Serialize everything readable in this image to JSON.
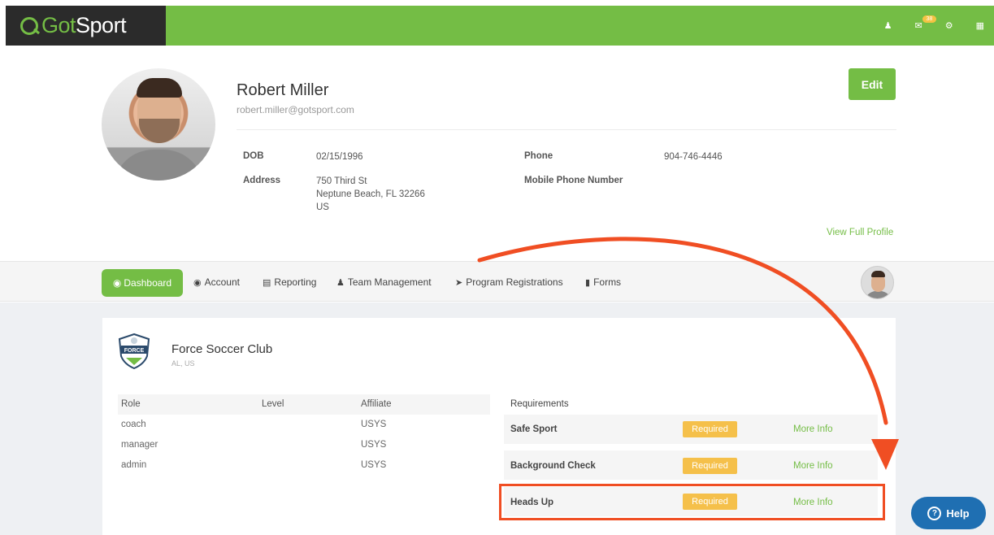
{
  "header": {
    "logo_prefix": "Got",
    "logo_suffix": "Sport",
    "mail_count": "38",
    "brand_color": "#74bd45"
  },
  "profile": {
    "name": "Robert Miller",
    "email": "robert.miller@gotsport.com",
    "edit_label": "Edit",
    "dob_label": "DOB",
    "dob_value": "02/15/1996",
    "address_label": "Address",
    "address_line1": "750 Third St",
    "address_line2": "Neptune Beach, FL 32266",
    "address_line3": "US",
    "phone_label": "Phone",
    "phone_value": "904-746-4446",
    "mobile_label": "Mobile Phone Number",
    "view_full_profile": "View Full Profile"
  },
  "nav": {
    "items": [
      {
        "label": "Dashboard",
        "icon": "dashboard-icon"
      },
      {
        "label": "Account",
        "icon": "user-circle-icon"
      },
      {
        "label": "Reporting",
        "icon": "document-icon"
      },
      {
        "label": "Team Management",
        "icon": "users-icon"
      },
      {
        "label": "Program Registrations",
        "icon": "paper-plane-icon"
      },
      {
        "label": "Forms",
        "icon": "file-icon"
      }
    ]
  },
  "club": {
    "name": "Force Soccer Club",
    "location": "AL, US",
    "logo_text": "FORCE"
  },
  "roles": {
    "headers": [
      "Role",
      "Level",
      "Affiliate"
    ],
    "rows": [
      {
        "role": "coach",
        "level": "",
        "affiliate": "USYS"
      },
      {
        "role": "manager",
        "level": "",
        "affiliate": "USYS"
      },
      {
        "role": "admin",
        "level": "",
        "affiliate": "USYS"
      }
    ]
  },
  "requirements": {
    "title": "Requirements",
    "items": [
      {
        "name": "Safe Sport",
        "status": "Required",
        "link": "More Info"
      },
      {
        "name": "Background Check",
        "status": "Required",
        "link": "More Info"
      },
      {
        "name": "Heads Up",
        "status": "Required",
        "link": "More Info"
      }
    ],
    "status_color": "#f5c04a",
    "highlight_color": "#f04e23"
  },
  "help": {
    "label": "Help"
  }
}
